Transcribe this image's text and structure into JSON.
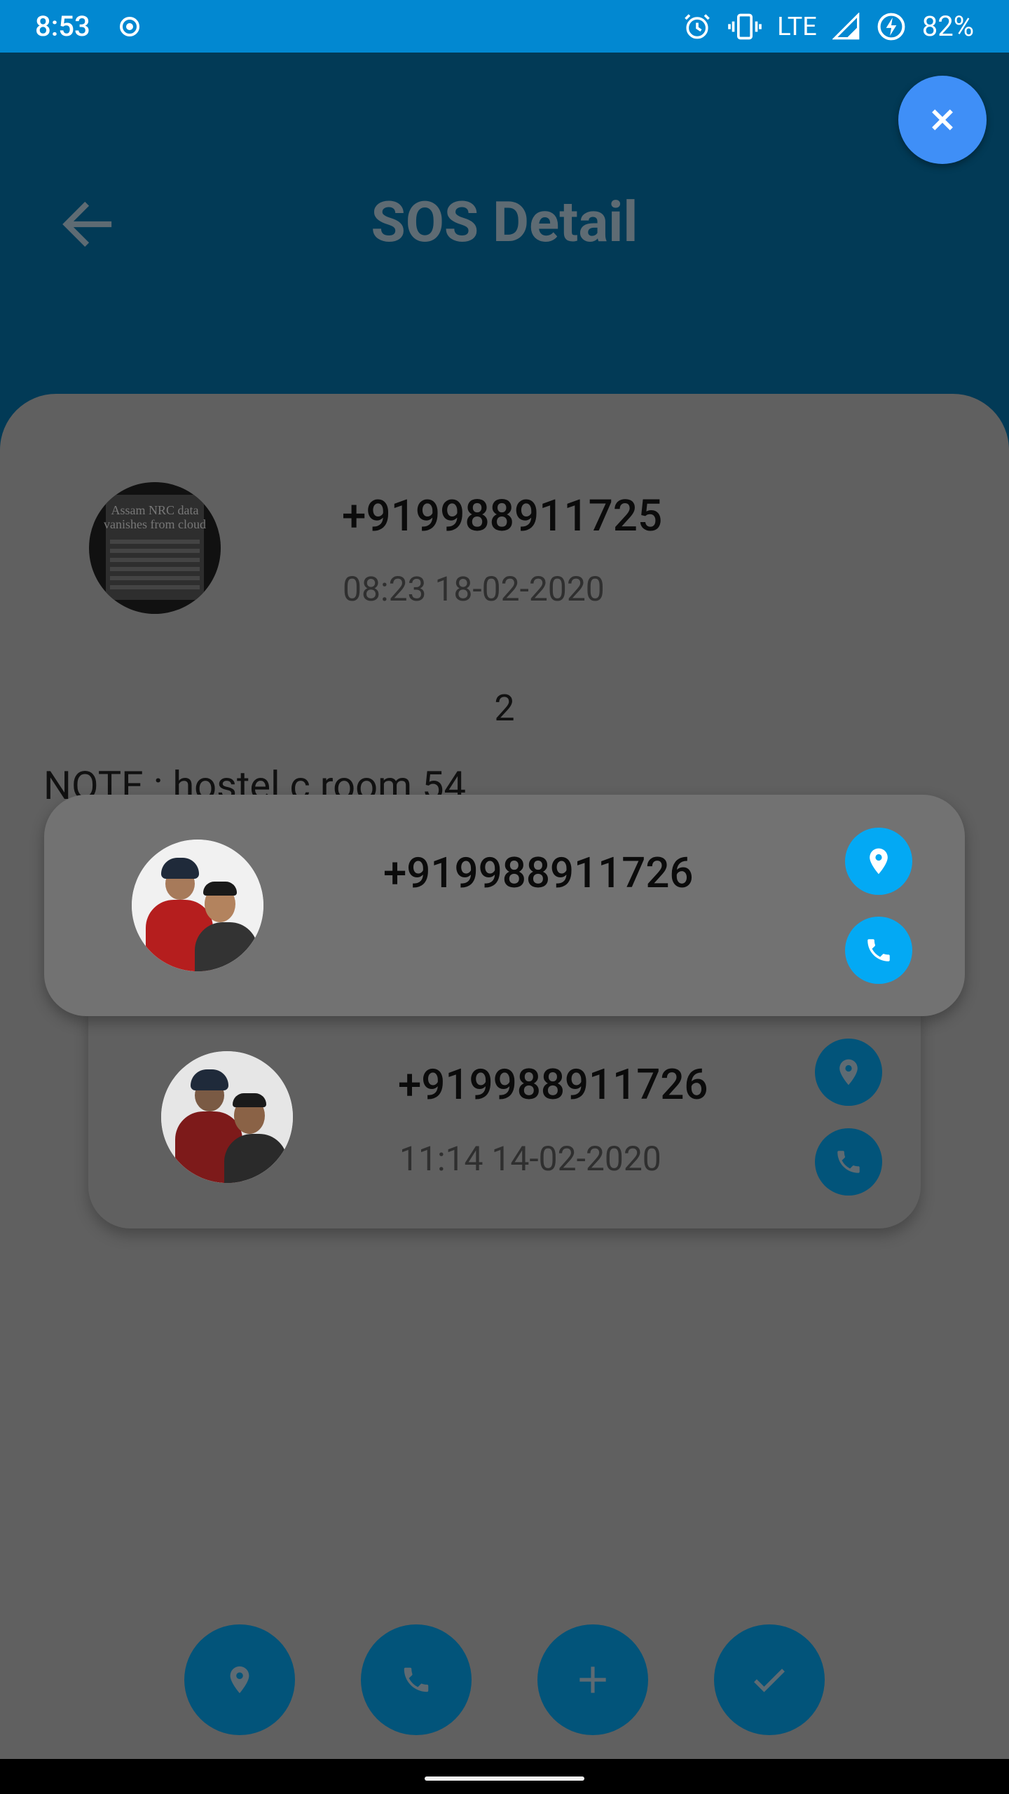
{
  "status_bar": {
    "time": "8:53",
    "network": "LTE",
    "battery": "82%",
    "icons": [
      "radio-icon",
      "alarm-icon",
      "vibrate-icon",
      "signal-icon",
      "battery-charging-icon"
    ]
  },
  "header": {
    "title": "SOS Detail",
    "back_icon": "arrow-back-icon",
    "close_icon": "close-icon"
  },
  "sos": {
    "phone": "+919988911725",
    "timestamp": "08:23 18-02-2020",
    "count": "2",
    "note": "NOTE : hostel c room 54",
    "avatar_text": "Assam NRC data vanishes from cloud"
  },
  "contacts": [
    {
      "phone": "+919988911726",
      "timestamp": ""
    },
    {
      "phone": "+919988911726",
      "timestamp": "11:14 14-02-2020"
    }
  ],
  "bottom_actions": [
    {
      "icon": "location-icon"
    },
    {
      "icon": "phone-icon"
    },
    {
      "icon": "plus-icon"
    },
    {
      "icon": "check-icon"
    }
  ],
  "colors": {
    "status_bar": "#0288d1",
    "header": "#023a56",
    "close_fab": "#3f8ff7",
    "action_bright": "#03a9f4",
    "action_dim": "#02547a",
    "scrim_background": "#606060"
  }
}
